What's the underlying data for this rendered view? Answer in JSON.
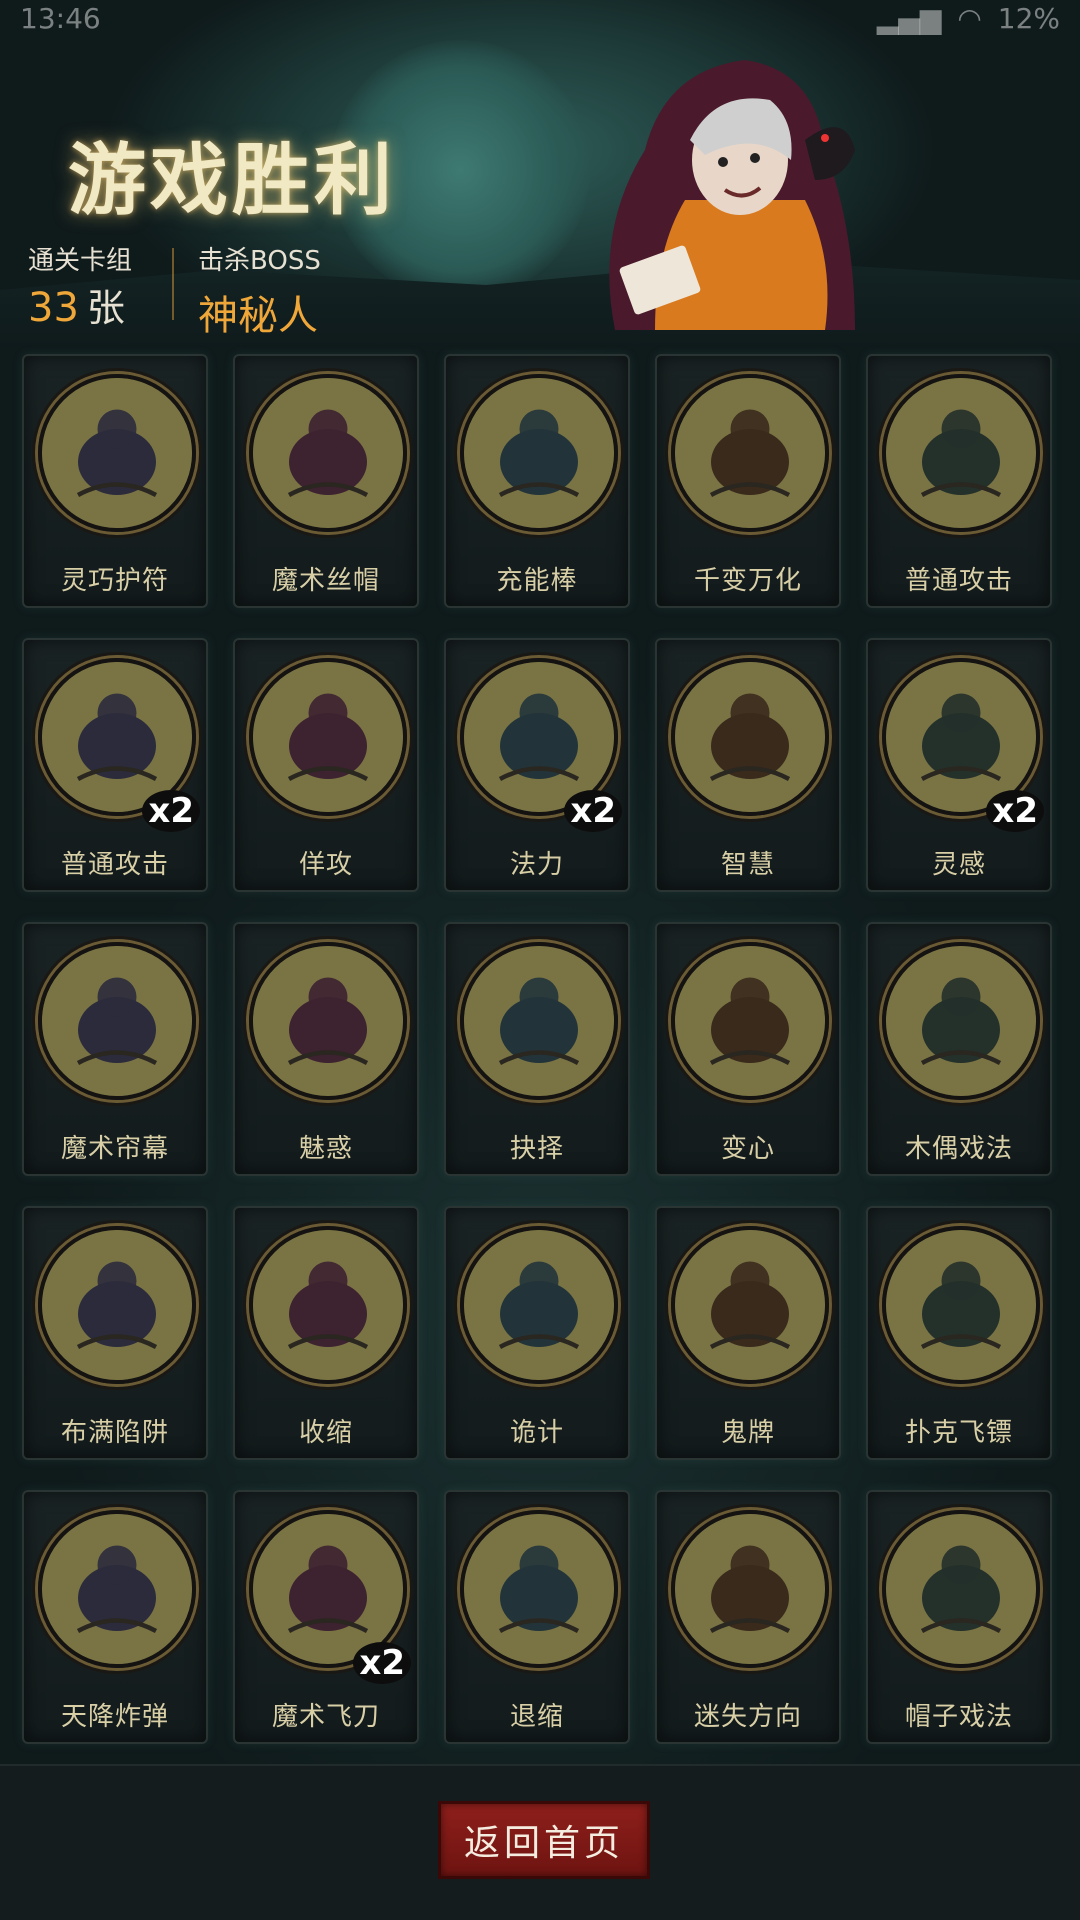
{
  "status": {
    "time": "13:46",
    "battery": "12%"
  },
  "header": {
    "title": "游戏胜利",
    "stat_deck_label": "通关卡组",
    "stat_deck_value": "33",
    "stat_deck_unit": "张",
    "stat_boss_label": "击杀BOSS",
    "stat_boss_value": "神秘人"
  },
  "cards": [
    {
      "label": "灵巧护符",
      "icon": "amulet-icon",
      "count": ""
    },
    {
      "label": "魔术丝帽",
      "icon": "top-hat-icon",
      "count": ""
    },
    {
      "label": "充能棒",
      "icon": "wand-icon",
      "count": ""
    },
    {
      "label": "千变万化",
      "icon": "jack-in-box-icon",
      "count": ""
    },
    {
      "label": "普通攻击",
      "icon": "feather-strike-icon",
      "count": ""
    },
    {
      "label": "普通攻击",
      "icon": "feather-strike-icon",
      "count": "x2"
    },
    {
      "label": "佯攻",
      "icon": "bandit-icon",
      "count": ""
    },
    {
      "label": "法力",
      "icon": "crystal-ball-icon",
      "count": "x2"
    },
    {
      "label": "智慧",
      "icon": "scholar-icon",
      "count": ""
    },
    {
      "label": "灵感",
      "icon": "skull-brain-icon",
      "count": "x2"
    },
    {
      "label": "魔术帘幕",
      "icon": "curtain-hat-icon",
      "count": ""
    },
    {
      "label": "魅惑",
      "icon": "charmed-goat-icon",
      "count": ""
    },
    {
      "label": "抉择",
      "icon": "wizard-icon",
      "count": ""
    },
    {
      "label": "变心",
      "icon": "imp-heart-icon",
      "count": ""
    },
    {
      "label": "木偶戏法",
      "icon": "puppet-icon",
      "count": ""
    },
    {
      "label": "布满陷阱",
      "icon": "spike-trap-icon",
      "count": ""
    },
    {
      "label": "收缩",
      "icon": "shrink-cowboy-icon",
      "count": ""
    },
    {
      "label": "诡计",
      "icon": "card-players-icon",
      "count": ""
    },
    {
      "label": "鬼牌",
      "icon": "joker-skull-icon",
      "count": ""
    },
    {
      "label": "扑克飞镖",
      "icon": "flying-card-icon",
      "count": ""
    },
    {
      "label": "天降炸弹",
      "icon": "balloon-bomb-icon",
      "count": ""
    },
    {
      "label": "魔术飞刀",
      "icon": "clown-knife-icon",
      "count": "x2"
    },
    {
      "label": "退缩",
      "icon": "retreat-icon",
      "count": ""
    },
    {
      "label": "迷失方向",
      "icon": "signpost-icon",
      "count": ""
    },
    {
      "label": "帽子戏法",
      "icon": "rabbit-hat-icon",
      "count": ""
    }
  ],
  "footer": {
    "home_button": "返回首页"
  },
  "colors": {
    "accent_gold": "#f0a73a",
    "button_red": "#8e1f1b",
    "medal": "#7d7747"
  }
}
